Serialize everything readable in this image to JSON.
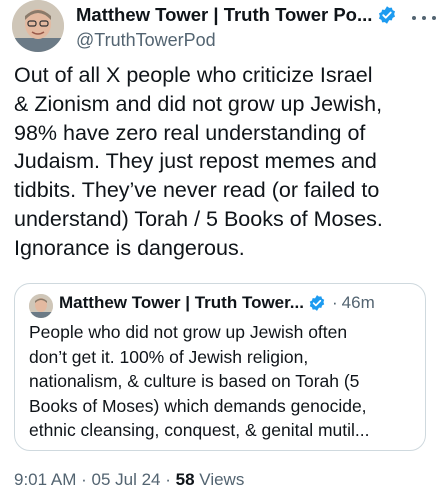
{
  "author": {
    "name": "Matthew Tower | Truth Tower Po...",
    "handle": "@TruthTowerPod"
  },
  "tweet": {
    "text": "Out of all X people who criticize Israel\n& Zionism and did not grow up Jewish,\n98% have zero real understanding of\nJudaism. They just repost memes and\ntidbits. They’ve never read (or failed to\nunderstand) Torah / 5 Books of Moses.\nIgnorance is dangerous.",
    "time": "9:01 AM",
    "date": "05 Jul 24",
    "views_count": "58",
    "views_label": "Views"
  },
  "quote": {
    "name": "Matthew Tower | Truth Tower...",
    "time": "46m",
    "text": "People who did not grow up Jewish often\ndon’t get it. 100% of Jewish religion,\nnationalism, & culture is based on Torah (5\nBooks of Moses) which demands genocide,\nethnic cleansing, conquest, & genital mutil..."
  },
  "colors": {
    "verified_blue": "#1d9bf0",
    "secondary_text": "#536471"
  },
  "icons": {
    "verified": "verified-badge-icon",
    "more": "more-options-icon"
  }
}
